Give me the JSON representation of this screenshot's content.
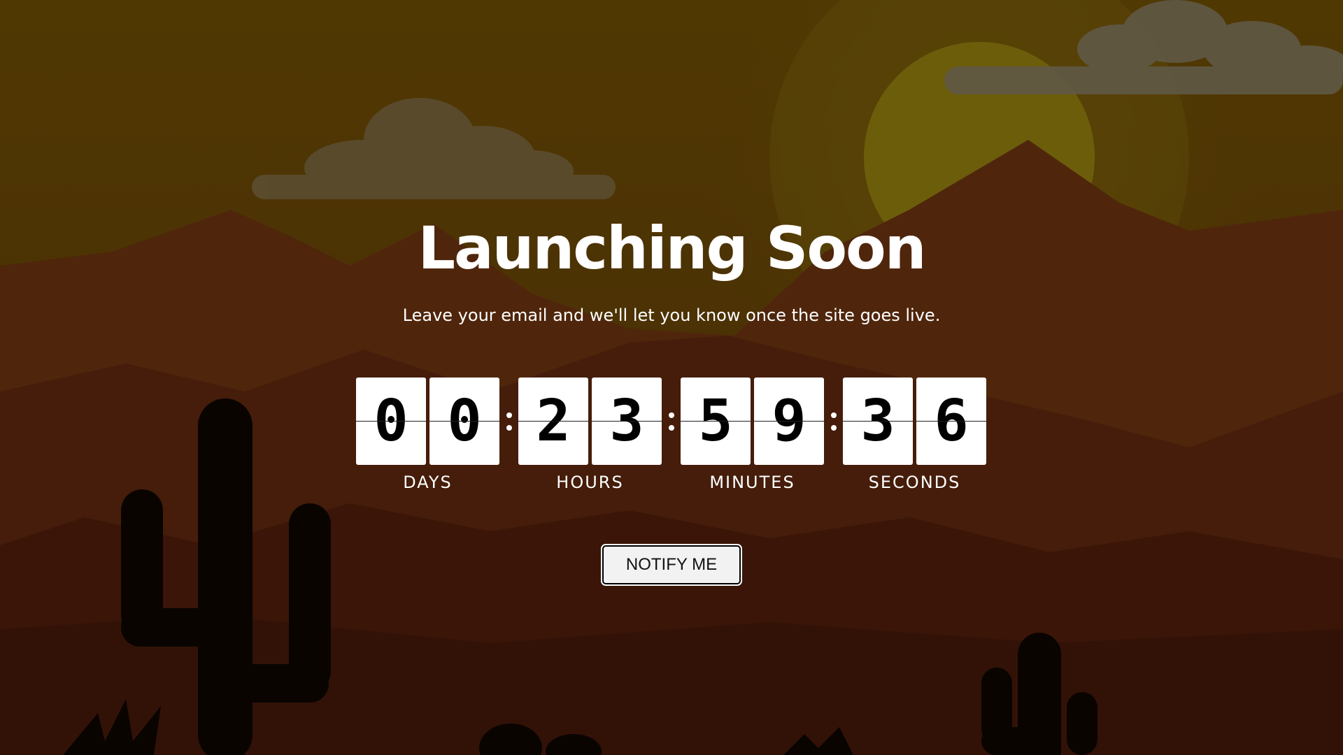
{
  "page": {
    "title": "Launching Soon",
    "subtitle": "Leave your email and we'll let you know once the site goes live."
  },
  "countdown": {
    "days": {
      "digits": [
        "0",
        "0"
      ],
      "label": "DAYS"
    },
    "hours": {
      "digits": [
        "2",
        "3"
      ],
      "label": "HOURS"
    },
    "minutes": {
      "digits": [
        "5",
        "9"
      ],
      "label": "MINUTES"
    },
    "seconds": {
      "digits": [
        "3",
        "6"
      ],
      "label": "SECONDS"
    }
  },
  "notify_button": {
    "label": "NOTIFY ME"
  },
  "colors": {
    "sky": "#5a3f05",
    "sun": "#7a6a0c",
    "mountain": "#5a2a0e",
    "foreground": "#3a1a0a",
    "cactus": "#0c0502",
    "text": "#ffffff"
  }
}
